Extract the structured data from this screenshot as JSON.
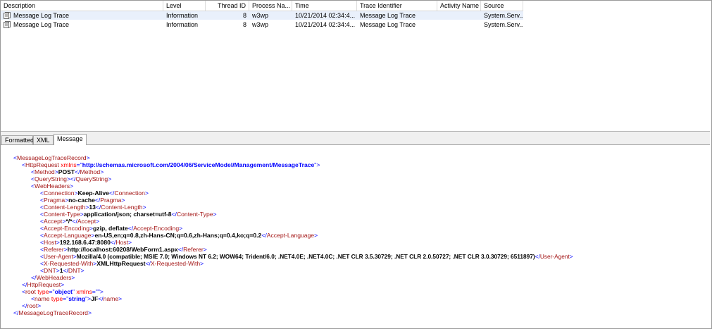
{
  "list": {
    "columns": [
      "Description",
      "Level",
      "Thread ID",
      "Process Na...",
      "Time",
      "Trace Identifier",
      "Activity Name",
      "Source"
    ],
    "rows": [
      {
        "icon": "document-icon",
        "description": "Message Log Trace",
        "level": "Information",
        "thread_id": "8",
        "process": "w3wp",
        "time": "10/21/2014 02:34:4...",
        "trace_identifier": "Message Log Trace",
        "activity_name": "",
        "source": "System.Serv..."
      },
      {
        "icon": "document-icon",
        "description": "Message Log Trace",
        "level": "Information",
        "thread_id": "8",
        "process": "w3wp",
        "time": "10/21/2014 02:34:4...",
        "trace_identifier": "Message Log Trace",
        "activity_name": "",
        "source": "System.Serv..."
      }
    ]
  },
  "tabs": [
    "Formatted",
    "XML",
    "Message"
  ],
  "active_tab": "Message",
  "xml": {
    "root_tag": "MessageLogTraceRecord",
    "http_request_tag": "HttpRequest",
    "xmlns_attr": "xmlns",
    "xmlns_value": "http://schemas.microsoft.com/2004/06/ServiceModel/Management/MessageTrace",
    "method_tag": "Method",
    "method_value": "POST",
    "query_tag": "QueryString",
    "webheaders_tag": "WebHeaders",
    "headers": [
      {
        "name": "Connection",
        "value": "Keep-Alive"
      },
      {
        "name": "Pragma",
        "value": "no-cache"
      },
      {
        "name": "Content-Length",
        "value": "13"
      },
      {
        "name": "Content-Type",
        "value": "application/json; charset=utf-8"
      },
      {
        "name": "Accept",
        "value": "*/*"
      },
      {
        "name": "Accept-Encoding",
        "value": "gzip, deflate"
      },
      {
        "name": "Accept-Language",
        "value": "en-US,en;q=0.8,zh-Hans-CN;q=0.6,zh-Hans;q=0.4,ko;q=0.2"
      },
      {
        "name": "Host",
        "value": "192.168.6.47:8080"
      },
      {
        "name": "Referer",
        "value": "http://localhost:60208/WebForm1.aspx"
      },
      {
        "name": "User-Agent",
        "value": "Mozilla/4.0 (compatible; MSIE 7.0; Windows NT 6.2; WOW64; Trident/6.0; .NET4.0E; .NET4.0C; .NET CLR 3.5.30729; .NET CLR 2.0.50727; .NET CLR 3.0.30729; 6511897)"
      },
      {
        "name": "X-Requested-With",
        "value": "XMLHttpRequest"
      },
      {
        "name": "DNT",
        "value": "1"
      }
    ],
    "root_obj_tag": "root",
    "type_attr": "type",
    "root_type_value": "object",
    "root_xmlns_value": "",
    "name_tag": "name",
    "name_type_value": "string",
    "name_value": "JF"
  }
}
